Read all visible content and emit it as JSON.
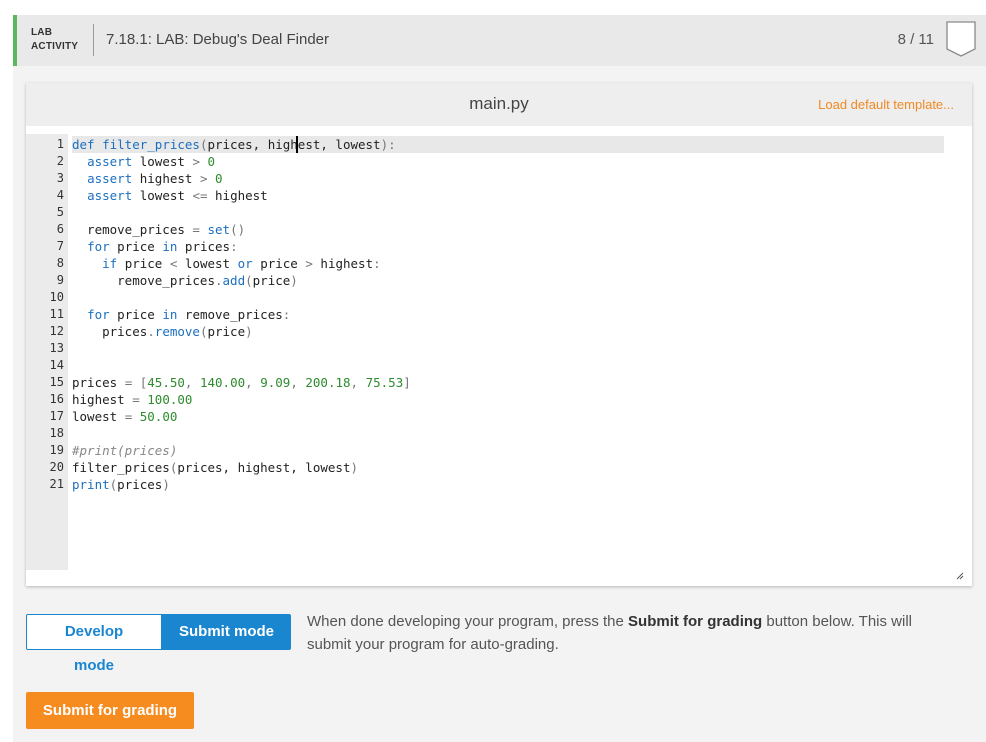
{
  "lab": {
    "tag_line1": "LAB",
    "tag_line2": "ACTIVITY",
    "title": "7.18.1: LAB: Debug's Deal Finder",
    "progress": "8 / 11",
    "accent_color": "#5bb85d"
  },
  "editor": {
    "file_name": "main.py",
    "load_template": "Load default template...",
    "lines": [
      {
        "n": "1",
        "segs": [
          [
            "kw",
            "def "
          ],
          [
            "fn",
            "filter_prices"
          ],
          [
            "p",
            "("
          ],
          [
            "t",
            "prices, highest, lowest"
          ],
          [
            "p",
            "):"
          ]
        ]
      },
      {
        "n": "2",
        "segs": [
          [
            "t",
            "  "
          ],
          [
            "kw",
            "assert"
          ],
          [
            "t",
            " lowest "
          ],
          [
            "p",
            ">"
          ],
          [
            "t",
            " "
          ],
          [
            "num",
            "0"
          ]
        ]
      },
      {
        "n": "3",
        "segs": [
          [
            "t",
            "  "
          ],
          [
            "kw",
            "assert"
          ],
          [
            "t",
            " highest "
          ],
          [
            "p",
            ">"
          ],
          [
            "t",
            " "
          ],
          [
            "num",
            "0"
          ]
        ]
      },
      {
        "n": "4",
        "segs": [
          [
            "t",
            "  "
          ],
          [
            "kw",
            "assert"
          ],
          [
            "t",
            " lowest "
          ],
          [
            "p",
            "<="
          ],
          [
            "t",
            " highest"
          ]
        ]
      },
      {
        "n": "5",
        "segs": []
      },
      {
        "n": "6",
        "segs": [
          [
            "t",
            "  remove_prices "
          ],
          [
            "p",
            "="
          ],
          [
            "t",
            " "
          ],
          [
            "bi",
            "set"
          ],
          [
            "p",
            "()"
          ]
        ]
      },
      {
        "n": "7",
        "segs": [
          [
            "t",
            "  "
          ],
          [
            "kw",
            "for"
          ],
          [
            "t",
            " price "
          ],
          [
            "kw",
            "in"
          ],
          [
            "t",
            " prices"
          ],
          [
            "p",
            ":"
          ]
        ]
      },
      {
        "n": "8",
        "segs": [
          [
            "t",
            "    "
          ],
          [
            "kw",
            "if"
          ],
          [
            "t",
            " price "
          ],
          [
            "p",
            "<"
          ],
          [
            "t",
            " lowest "
          ],
          [
            "kw",
            "or"
          ],
          [
            "t",
            " price "
          ],
          [
            "p",
            ">"
          ],
          [
            "t",
            " highest"
          ],
          [
            "p",
            ":"
          ]
        ]
      },
      {
        "n": "9",
        "segs": [
          [
            "t",
            "      remove_prices"
          ],
          [
            "p",
            "."
          ],
          [
            "meth",
            "add"
          ],
          [
            "p",
            "("
          ],
          [
            "t",
            "price"
          ],
          [
            "p",
            ")"
          ]
        ]
      },
      {
        "n": "10",
        "segs": []
      },
      {
        "n": "11",
        "segs": [
          [
            "t",
            "  "
          ],
          [
            "kw",
            "for"
          ],
          [
            "t",
            " price "
          ],
          [
            "kw",
            "in"
          ],
          [
            "t",
            " remove_prices"
          ],
          [
            "p",
            ":"
          ]
        ]
      },
      {
        "n": "12",
        "segs": [
          [
            "t",
            "    prices"
          ],
          [
            "p",
            "."
          ],
          [
            "meth",
            "remove"
          ],
          [
            "p",
            "("
          ],
          [
            "t",
            "price"
          ],
          [
            "p",
            ")"
          ]
        ]
      },
      {
        "n": "13",
        "segs": []
      },
      {
        "n": "14",
        "segs": []
      },
      {
        "n": "15",
        "segs": [
          [
            "t",
            "prices "
          ],
          [
            "p",
            "="
          ],
          [
            "t",
            " "
          ],
          [
            "p",
            "["
          ],
          [
            "num",
            "45.50"
          ],
          [
            "p",
            ", "
          ],
          [
            "num",
            "140.00"
          ],
          [
            "p",
            ", "
          ],
          [
            "num",
            "9.09"
          ],
          [
            "p",
            ", "
          ],
          [
            "num",
            "200.18"
          ],
          [
            "p",
            ", "
          ],
          [
            "num",
            "75.53"
          ],
          [
            "p",
            "]"
          ]
        ]
      },
      {
        "n": "16",
        "segs": [
          [
            "t",
            "highest "
          ],
          [
            "p",
            "="
          ],
          [
            "t",
            " "
          ],
          [
            "num",
            "100.00"
          ]
        ]
      },
      {
        "n": "17",
        "segs": [
          [
            "t",
            "lowest "
          ],
          [
            "p",
            "="
          ],
          [
            "t",
            " "
          ],
          [
            "num",
            "50.00"
          ]
        ]
      },
      {
        "n": "18",
        "segs": []
      },
      {
        "n": "19",
        "segs": [
          [
            "cm",
            "#print(prices)"
          ]
        ]
      },
      {
        "n": "20",
        "segs": [
          [
            "t",
            "filter_prices"
          ],
          [
            "p",
            "("
          ],
          [
            "t",
            "prices, highest, lowest"
          ],
          [
            "p",
            ")"
          ]
        ]
      },
      {
        "n": "21",
        "segs": [
          [
            "bi",
            "print"
          ],
          [
            "p",
            "("
          ],
          [
            "t",
            "prices"
          ],
          [
            "p",
            ")"
          ]
        ]
      }
    ],
    "syntax_colors": {
      "kw": "#1c6fbf",
      "fn": "#1c6fbf",
      "bi": "#1c6fbf",
      "meth": "#1c6fbf",
      "num": "#2e8b2e",
      "p": "#777777",
      "t": "#222222",
      "cm": "#888888"
    }
  },
  "modes": {
    "develop_label": "Develop mode",
    "submit_label": "Submit mode",
    "active": "submit"
  },
  "help": {
    "pre": "When done developing your program, press the ",
    "strong": "Submit for grading",
    "post": " button below. This will submit your program for auto-grading."
  },
  "submit_button": {
    "label": "Submit for grading",
    "color": "#f68b1f"
  }
}
